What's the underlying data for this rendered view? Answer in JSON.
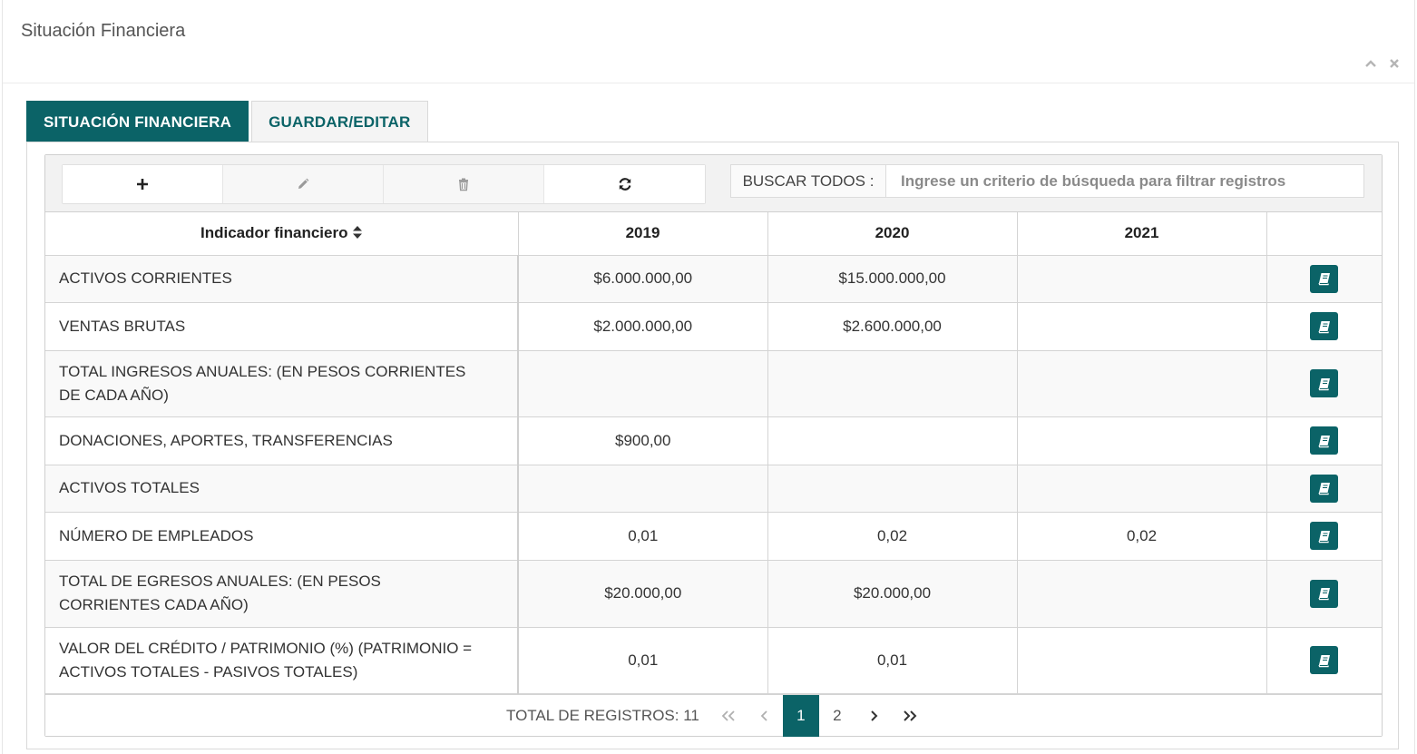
{
  "portlet": {
    "title": "Situación Financiera"
  },
  "tabs": [
    {
      "label": "SITUACIÓN FINANCIERA",
      "active": true
    },
    {
      "label": "GUARDAR/EDITAR",
      "active": false
    }
  ],
  "toolbar": {
    "buttons": [
      {
        "icon": "plus-icon",
        "enabled": true
      },
      {
        "icon": "pencil-icon",
        "enabled": false
      },
      {
        "icon": "trash-icon",
        "enabled": false
      },
      {
        "icon": "refresh-icon",
        "enabled": true
      }
    ],
    "search_label": "BUSCAR TODOS :",
    "search_placeholder": "Ingrese un criterio de búsqueda para filtrar registros",
    "search_value": ""
  },
  "table": {
    "columns": [
      "Indicador financiero",
      "2019",
      "2020",
      "2021",
      ""
    ],
    "rows": [
      {
        "label": "ACTIVOS CORRIENTES",
        "y2019": "$6.000.000,00",
        "y2020": "$15.000.000,00",
        "y2021": ""
      },
      {
        "label": "VENTAS BRUTAS",
        "y2019": "$2.000.000,00",
        "y2020": "$2.600.000,00",
        "y2021": ""
      },
      {
        "label": "TOTAL INGRESOS ANUALES: (EN PESOS CORRIENTES DE CADA AÑO)",
        "y2019": "",
        "y2020": "",
        "y2021": ""
      },
      {
        "label": "DONACIONES, APORTES, TRANSFERENCIAS",
        "y2019": "$900,00",
        "y2020": "",
        "y2021": ""
      },
      {
        "label": "ACTIVOS TOTALES",
        "y2019": "",
        "y2020": "",
        "y2021": ""
      },
      {
        "label": "NÚMERO DE EMPLEADOS",
        "y2019": "0,01",
        "y2020": "0,02",
        "y2021": "0,02"
      },
      {
        "label": "TOTAL DE EGRESOS ANUALES: (EN PESOS CORRIENTES CADA AÑO)",
        "y2019": "$20.000,00",
        "y2020": "$20.000,00",
        "y2021": ""
      },
      {
        "label": "VALOR DEL CRÉDITO / PATRIMONIO (%) (PATRIMONIO = ACTIVOS TOTALES - PASIVOS TOTALES)",
        "y2019": "0,01",
        "y2020": "0,01",
        "y2021": ""
      }
    ]
  },
  "pager": {
    "total_label": "TOTAL DE REGISTROS: 11",
    "pages": [
      "1",
      "2"
    ],
    "current_page": "1"
  },
  "colors": {
    "primary": "#0b6367"
  }
}
